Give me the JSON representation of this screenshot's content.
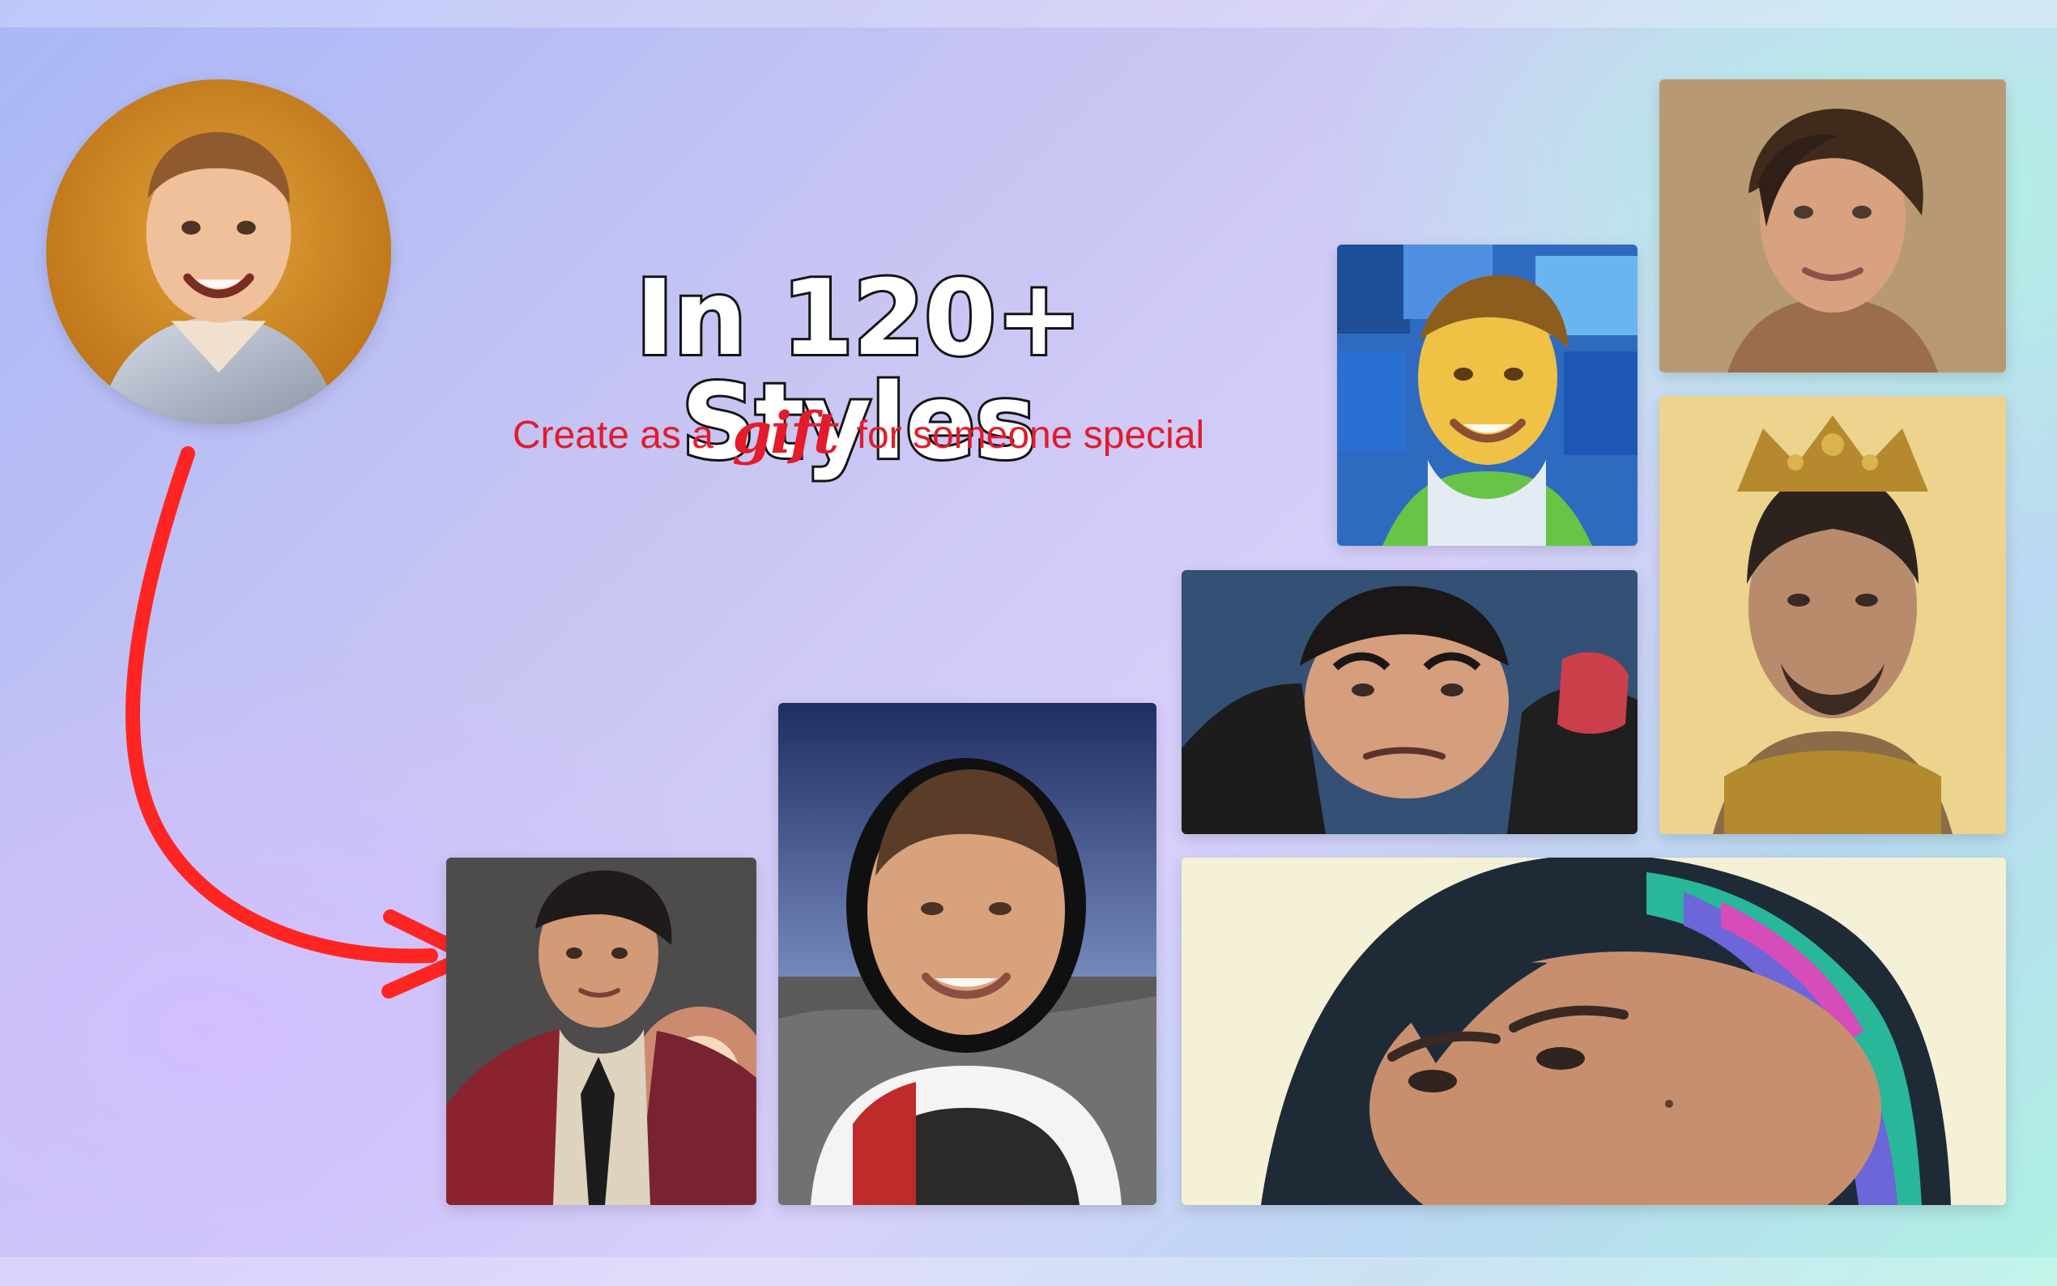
{
  "headline": "In 120+ Styles",
  "subheadline": {
    "before": "Create as a",
    "emphasis": "gift",
    "after": "for someone special"
  },
  "colors": {
    "headline_fill": "#ffffff",
    "headline_outline": "#141414",
    "accent_red": "#e31b2c"
  },
  "icons": {
    "arrow": "curved-red-arrow"
  },
  "images": {
    "source_photo": "original portrait photo",
    "results": [
      "realistic portrait",
      "oil painting portrait",
      "royal crown portrait",
      "comic book portrait",
      "astronaut portrait",
      "suit portrait",
      "anime colorful hair portrait"
    ]
  }
}
